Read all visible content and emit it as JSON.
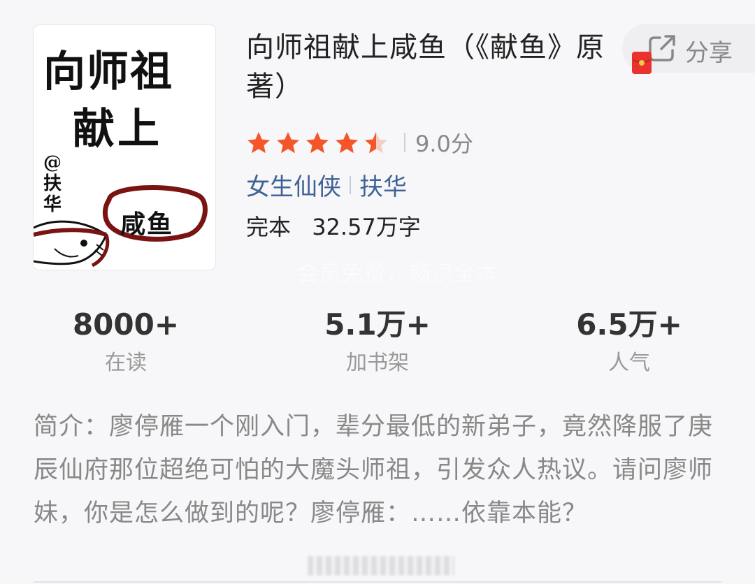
{
  "book": {
    "cover": {
      "title_line1": "向师祖",
      "title_line2": "献上",
      "author": "@扶华",
      "fish_text": "咸鱼"
    },
    "title": "向师祖献上咸鱼（《献鱼》原著）",
    "share_label": "分享",
    "rating": {
      "stars": 4.5,
      "score_text": "9.0分"
    },
    "tags": [
      "女生仙侠",
      "扶华"
    ],
    "status": "完本",
    "word_count": "32.57万字",
    "member_tip": "会员免费，畅读全本"
  },
  "stats": [
    {
      "value": "8000+",
      "label": "在读"
    },
    {
      "value": "5.1万+",
      "label": "加书架"
    },
    {
      "value": "6.5万+",
      "label": "人气"
    }
  ],
  "intro": "简介：廖停雁一个刚入门，辈分最低的新弟子，竟然降服了庚辰仙府那位超绝可怕的大魔头师祖，引发众人热议。请问廖师妹，你是怎么做到的呢？廖停雁：……依靠本能？",
  "colors": {
    "star": "#f4562a",
    "link": "#3f6396",
    "red_packet": "#e8332f"
  },
  "icons": [
    "share-icon",
    "red-packet-icon",
    "star-icon"
  ]
}
